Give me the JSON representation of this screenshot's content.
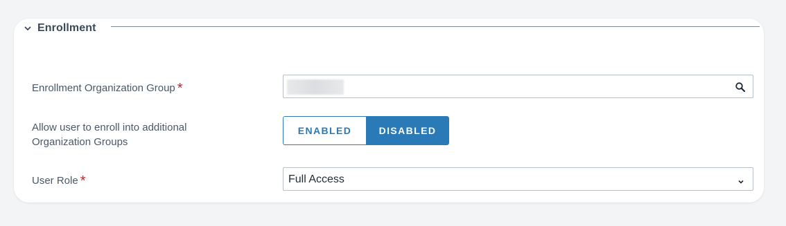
{
  "section": {
    "title": "Enrollment"
  },
  "fields": {
    "org_group": {
      "label": "Enrollment Organization Group",
      "required_mark": "*"
    },
    "additional_groups": {
      "label_line1": "Allow user to enroll into additional",
      "label_line2": "Organization Groups",
      "options": [
        "ENABLED",
        "DISABLED"
      ],
      "selected": "DISABLED"
    },
    "user_role": {
      "label": "User Role",
      "required_mark": "*",
      "value": "Full Access"
    }
  },
  "icons": {
    "section_toggle": "chevron-down-icon",
    "org_group_lookup": "search-icon",
    "user_role_dropdown": "chevron-down-icon"
  },
  "colors": {
    "accent": "#2a7ab8",
    "required": "#c6262b",
    "label": "#4a5868",
    "background": "#f3f4f6"
  }
}
